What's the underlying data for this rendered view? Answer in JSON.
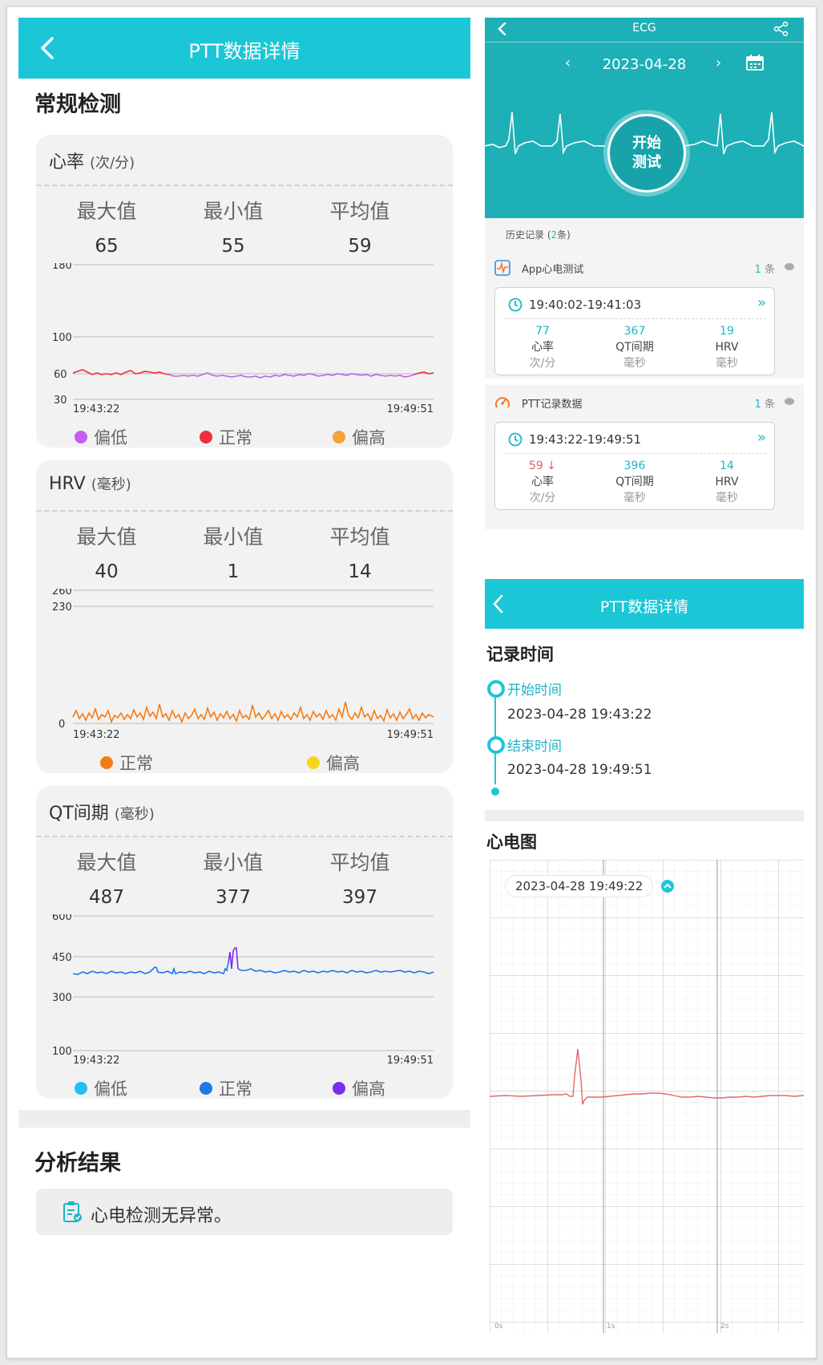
{
  "left_panel": {
    "title": "PTT数据详情",
    "section_title": "常规检测",
    "stat_labels": {
      "max": "最大值",
      "min": "最小值",
      "avg": "平均值"
    },
    "heart_rate": {
      "title": "心率",
      "unit": "(次/分)",
      "max": "65",
      "min": "55",
      "avg": "59",
      "y_ticks": [
        "180",
        "100",
        "60",
        "30"
      ],
      "x_start": "19:43:22",
      "x_end": "19:49:51",
      "legend": [
        "偏低",
        "正常",
        "偏高"
      ],
      "colors": [
        "#c45ef0",
        "#ee2f3c",
        "#f7a23b"
      ]
    },
    "hrv": {
      "title": "HRV",
      "unit": "(毫秒)",
      "max": "40",
      "min": "1",
      "avg": "14",
      "y_ticks": [
        "260",
        "230",
        "0"
      ],
      "x_start": "19:43:22",
      "x_end": "19:49:51",
      "legend": [
        "正常",
        "偏高"
      ],
      "colors": [
        "#f57c14",
        "#f7d51d"
      ]
    },
    "qt": {
      "title": "QT间期",
      "unit": "(毫秒)",
      "max": "487",
      "min": "377",
      "avg": "397",
      "y_ticks": [
        "600",
        "450",
        "300",
        "100"
      ],
      "x_start": "19:43:22",
      "x_end": "19:49:51",
      "legend": [
        "偏低",
        "正常",
        "偏高"
      ],
      "colors": [
        "#1fc0f5",
        "#1e78e6",
        "#7b2ef0"
      ]
    },
    "analysis_title": "分析结果",
    "analysis_text": "心电检测无异常。"
  },
  "right_top": {
    "title": "ECG",
    "date": "2023-04-28",
    "start_button": [
      "开始",
      "测试"
    ],
    "history_prefix": "历史记录 (",
    "history_count": "2",
    "history_suffix": "条)",
    "groups": [
      {
        "name": "App心电测试",
        "count": "1",
        "count_unit": "条",
        "time": "19:40:02-19:41:03",
        "metrics": [
          {
            "value": "77",
            "name": "心率",
            "unit": "次/分"
          },
          {
            "value": "367",
            "name": "QT间期",
            "unit": "毫秒"
          },
          {
            "value": "19",
            "name": "HRV",
            "unit": "毫秒"
          }
        ]
      },
      {
        "name": "PTT记录数据",
        "count": "1",
        "count_unit": "条",
        "time": "19:43:22-19:49:51",
        "metrics": [
          {
            "value": "59 ↓",
            "name": "心率",
            "unit": "次/分"
          },
          {
            "value": "396",
            "name": "QT间期",
            "unit": "毫秒"
          },
          {
            "value": "14",
            "name": "HRV",
            "unit": "毫秒"
          }
        ]
      }
    ]
  },
  "right_bottom": {
    "title": "PTT数据详情",
    "record_time_title": "记录时间",
    "start_label": "开始时间",
    "start_value": "2023-04-28 19:43:22",
    "end_label": "结束时间",
    "end_value": "2023-04-28 19:49:51",
    "ecg_title": "心电图",
    "ecg_timestamp": "2023-04-28 19:49:22",
    "ecg_x_ticks": [
      "0s",
      "1s",
      "2s"
    ]
  },
  "colors": {
    "accent": "#1bc7d6",
    "ecg_header": "#1db0b6",
    "ecg_line": "#e06a6a"
  }
}
